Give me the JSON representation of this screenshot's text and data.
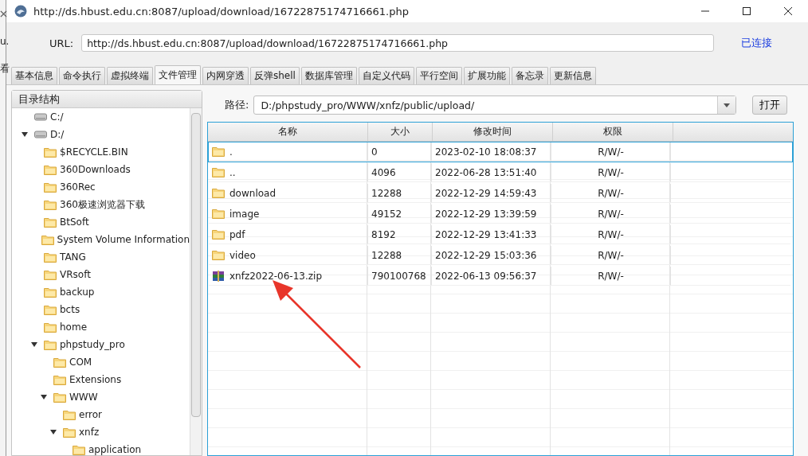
{
  "background_window": {
    "texts": [
      "u.",
      "看"
    ]
  },
  "window": {
    "title": "http://ds.hbust.edu.cn:8087/upload/download/16722875174716661.php"
  },
  "url_bar": {
    "label": "URL:",
    "value": "http://ds.hbust.edu.cn:8087/upload/download/16722875174716661.php",
    "status": "已连接"
  },
  "tabs": [
    {
      "label": "基本信息",
      "selected": false
    },
    {
      "label": "命令执行",
      "selected": false
    },
    {
      "label": "虚拟终端",
      "selected": false
    },
    {
      "label": "文件管理",
      "selected": true
    },
    {
      "label": "内网穿透",
      "selected": false
    },
    {
      "label": "反弹shell",
      "selected": false
    },
    {
      "label": "数据库管理",
      "selected": false
    },
    {
      "label": "自定义代码",
      "selected": false
    },
    {
      "label": "平行空间",
      "selected": false
    },
    {
      "label": "扩展功能",
      "selected": false
    },
    {
      "label": "备忘录",
      "selected": false
    },
    {
      "label": "更新信息",
      "selected": false
    }
  ],
  "tree": {
    "title": "目录结构",
    "items": [
      {
        "label": "C:/",
        "kind": "drive",
        "expanded": false
      },
      {
        "label": "D:/",
        "kind": "drive",
        "expanded": true,
        "children": [
          {
            "label": "$RECYCLE.BIN",
            "kind": "folder",
            "expanded": false
          },
          {
            "label": "360Downloads",
            "kind": "folder",
            "expanded": false
          },
          {
            "label": "360Rec",
            "kind": "folder",
            "expanded": false
          },
          {
            "label": "360极速浏览器下载",
            "kind": "folder",
            "expanded": false
          },
          {
            "label": "BtSoft",
            "kind": "folder",
            "expanded": false
          },
          {
            "label": "System Volume Information",
            "kind": "folder",
            "expanded": false
          },
          {
            "label": "TANG",
            "kind": "folder",
            "expanded": false
          },
          {
            "label": "VRsoft",
            "kind": "folder",
            "expanded": false
          },
          {
            "label": "backup",
            "kind": "folder",
            "expanded": false
          },
          {
            "label": "bcts",
            "kind": "folder",
            "expanded": false
          },
          {
            "label": "home",
            "kind": "folder",
            "expanded": false
          },
          {
            "label": "phpstudy_pro",
            "kind": "folder",
            "expanded": true,
            "children": [
              {
                "label": "COM",
                "kind": "folder",
                "expanded": false
              },
              {
                "label": "Extensions",
                "kind": "folder",
                "expanded": false
              },
              {
                "label": "WWW",
                "kind": "folder",
                "expanded": true,
                "children": [
                  {
                    "label": "error",
                    "kind": "folder",
                    "expanded": false
                  },
                  {
                    "label": "xnfz",
                    "kind": "folder",
                    "expanded": true,
                    "children": [
                      {
                        "label": "application",
                        "kind": "folder",
                        "expanded": false
                      }
                    ]
                  }
                ]
              }
            ]
          }
        ]
      }
    ]
  },
  "path_bar": {
    "label": "路径:",
    "value": "D:/phpstudy_pro/WWW/xnfz/public/upload/",
    "button": "打开"
  },
  "table": {
    "columns": [
      "名称",
      "大小",
      "修改时间",
      "权限"
    ],
    "rows": [
      {
        "kind": "folder",
        "name": ".",
        "size": "0",
        "modified": "2023-02-10 18:08:37",
        "permission": "R/W/-",
        "selected": true
      },
      {
        "kind": "folder",
        "name": "..",
        "size": "4096",
        "modified": "2022-06-28 13:51:40",
        "permission": "R/W/-",
        "selected": false
      },
      {
        "kind": "folder",
        "name": "download",
        "size": "12288",
        "modified": "2022-12-29 14:59:43",
        "permission": "R/W/-",
        "selected": false
      },
      {
        "kind": "folder",
        "name": "image",
        "size": "49152",
        "modified": "2022-12-29 13:39:59",
        "permission": "R/W/-",
        "selected": false
      },
      {
        "kind": "folder",
        "name": "pdf",
        "size": "8192",
        "modified": "2022-12-29 13:41:33",
        "permission": "R/W/-",
        "selected": false
      },
      {
        "kind": "folder",
        "name": "video",
        "size": "12288",
        "modified": "2022-12-29 15:03:36",
        "permission": "R/W/-",
        "selected": false
      },
      {
        "kind": "archive",
        "name": "xnfz2022-06-13.zip",
        "size": "790100768",
        "modified": "2022-06-13 09:56:37",
        "permission": "R/W/-",
        "selected": false
      }
    ]
  }
}
